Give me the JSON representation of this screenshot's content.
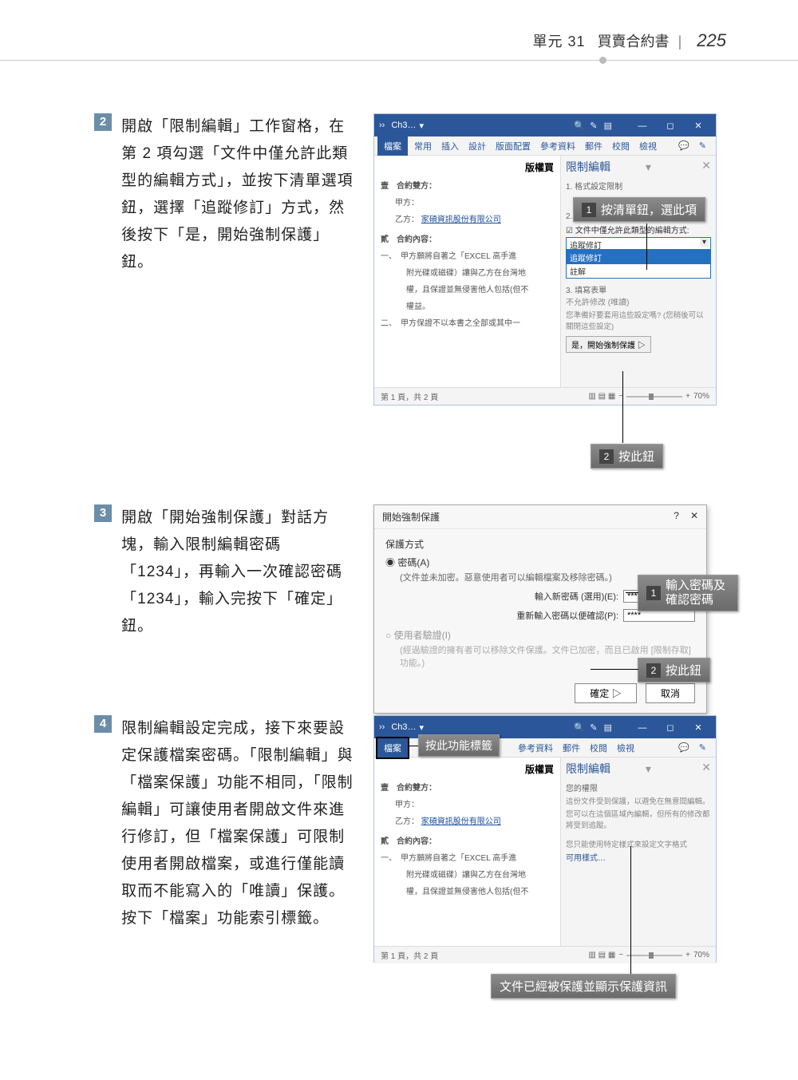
{
  "header": {
    "unit": "單元 31",
    "title": "買賣合約書",
    "page": "225"
  },
  "steps": {
    "s2": {
      "num": "2",
      "text": "開啟「限制編輯」工作窗格，在第 2 項勾選「文件中僅允許此類型的編輯方式」，並按下清單選項鈕，選擇「追蹤修訂」方式，然後按下「是，開始強制保護」鈕。"
    },
    "s3": {
      "num": "3",
      "text": "開啟「開始強制保護」對話方塊，輸入限制編輯密碼「1234」，再輸入一次確認密碼「1234」，輸入完按下「確定」鈕。"
    },
    "s4": {
      "num": "4",
      "text": "限制編輯設定完成，接下來要設定保護檔案密碼。「限制編輯」與「檔案保護」功能不相同，「限制編輯」可讓使用者開啟文件來進行修訂，但「檔案保護」可限制使用者開啟檔案，或進行僅能讀取而不能寫入的「唯讀」保護。按下「檔案」功能索引標籤。"
    }
  },
  "word": {
    "doc_name": "Ch3…",
    "tabs": {
      "file": "檔案",
      "home": "常用",
      "insert": "插入",
      "design": "設計",
      "layout": "版面配置",
      "ref": "參考資料",
      "mail": "郵件",
      "review": "校閱",
      "view": "檢視"
    },
    "doc_title": "版權買",
    "body": {
      "party_title": "壹　合約雙方：",
      "partyA": "甲方：",
      "partyB_label": "乙方：",
      "partyB_val": "家碩資訊股份有限公司",
      "content_title": "貳　合約內容：",
      "c1": "一、　甲方願將自著之「EXCEL 高手進",
      "c1b": "附光碟或磁碟）讓與乙方在台灣地",
      "c1c": "權，且保證並無侵害他人包括(但不",
      "c1d": "權益。",
      "c2": "二、　甲方保證不以本書之全部或其中一"
    },
    "pane": {
      "title": "限制編輯",
      "sec1": "1. 格式設定限制",
      "sec2": "2. 編輯限制",
      "chk": "文件中僅允許此類型的編輯方式:",
      "combo_sel": "追蹤修訂",
      "opt_sel": "追蹤修訂",
      "opt2": "註解",
      "sec3": "3. 填寫表單",
      "noedit": "不允許修改 (唯讀)",
      "note": "您準備好要套用這些設定嗎? (您稍後可以關閉這些設定)",
      "btn": "是，開始強制保護",
      "prot_title": "您的權限",
      "prot1": "這份文件受到保護，以避免在無意間編輯。",
      "prot2": "您可以在這個區域內編輯，但所有的修改都將受到追蹤。",
      "prot3": "您只能使用特定樣式來設定文字格式",
      "prot_link": "可用樣式…"
    },
    "status": {
      "page": "第 1 頁，共 2 頁",
      "zoom": "70%"
    }
  },
  "dialog": {
    "title": "開始強制保護",
    "method": "保護方式",
    "pwd": "密碼(A)",
    "pwd_note": "(文件並未加密。惡意使用者可以編輯檔案及移除密碼。)",
    "pw1_label": "輸入新密碼 (選用)(E):",
    "pw2_label": "重新輸入密碼以便確認(P):",
    "pw_val": "****",
    "auth": "使用者驗證(I)",
    "auth_note": "(經過驗證的擁有者可以移除文件保護。文件已加密，而且已啟用 [限制存取] 功能。)",
    "ok": "確定",
    "cancel": "取消"
  },
  "callouts": {
    "c2a": "按清單鈕，選此項",
    "c2b": "按此鈕",
    "c3a": "輸入密碼及確認密碼",
    "c3b": "按此鈕",
    "c4a": "按此功能標籤",
    "c4b": "文件已經被保護並顯示保護資訊"
  }
}
